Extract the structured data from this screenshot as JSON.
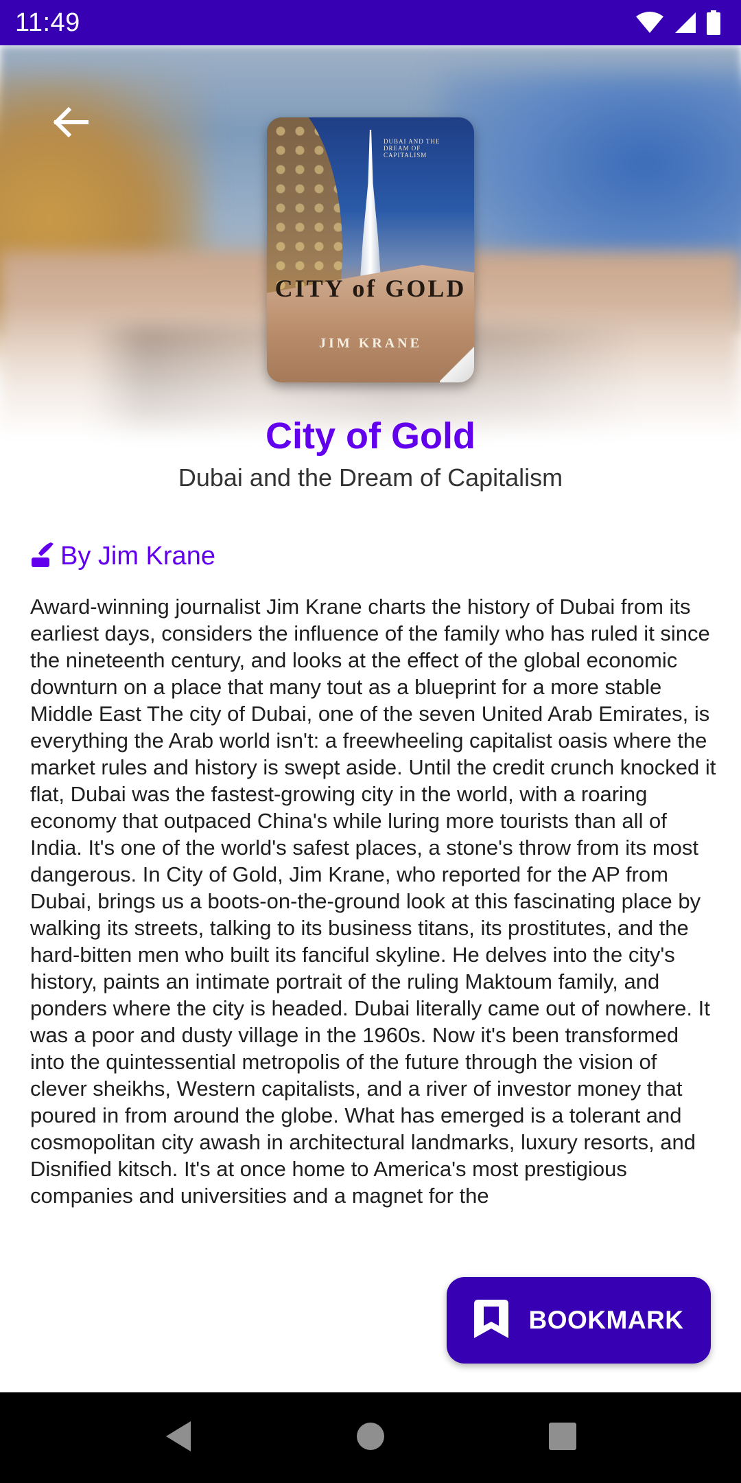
{
  "status_bar": {
    "time": "11:49",
    "icons": [
      "wifi-icon",
      "cell-signal-icon",
      "battery-icon"
    ]
  },
  "header": {
    "back_icon": "arrow-back-icon"
  },
  "cover": {
    "tagline": "Dubai and the Dream of Capitalism",
    "title": "CITY of GOLD",
    "author": "JIM KRANE"
  },
  "book": {
    "title": "City of Gold",
    "subtitle": "Dubai and the Dream of Capitalism",
    "author_label": "By Jim Krane",
    "author_icon": "quill-pen-icon",
    "description": "Award-winning journalist Jim Krane charts the history of Dubai from its earliest days, considers the influence of the family who has ruled it since the nineteenth century, and looks at the effect of the global economic downturn on a place that many tout as a blueprint for a more stable Middle East The city of Dubai, one of the seven United Arab Emirates, is everything the Arab world isn't: a freewheeling capitalist oasis where the market rules and history is swept aside. Until the credit crunch knocked it flat, Dubai was the fastest-growing city in the world, with a roaring economy that outpaced China's while luring more tourists than all of India. It's one of the world's safest places, a stone's throw from its most dangerous. In City of Gold, Jim Krane, who reported for the AP from Dubai, brings us a boots-on-the-ground look at this fascinating place by walking its streets, talking to its business titans, its prostitutes, and the hard-bitten men who built its fanciful skyline. He delves into the city's history, paints an intimate portrait of the ruling Maktoum family, and ponders where the city is headed. Dubai literally came out of nowhere. It was a poor and dusty village in the 1960s. Now it's been transformed into the quintessential metropolis of the future through the vision of clever sheikhs, Western capitalists, and a river of investor money that poured in from around the globe. What has emerged is a tolerant and cosmopolitan city awash in architectural landmarks, luxury resorts, and Disnified kitsch. It's at once home to America's most prestigious companies and universities and a magnet for the"
  },
  "actions": {
    "bookmark_label": "BOOKMARK",
    "bookmark_icon": "bookmark-icon"
  },
  "nav_bar": {
    "icons": [
      "back-triangle-icon",
      "home-circle-icon",
      "recents-square-icon"
    ]
  },
  "colors": {
    "status_bar": "#3700b3",
    "primary": "#6200ee",
    "button": "#3700b3"
  }
}
